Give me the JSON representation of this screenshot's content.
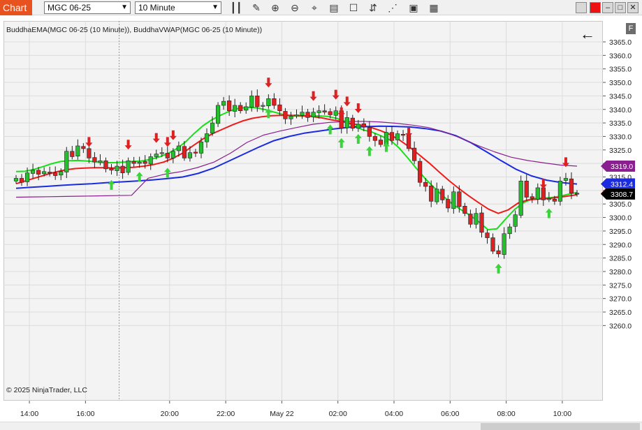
{
  "toolbar": {
    "tab_label": "Chart",
    "instrument": "MGC 06-25",
    "interval": "10 Minute",
    "icons": [
      "bar-type-icon",
      "draw-pencil-icon",
      "zoom-in-icon",
      "zoom-out-icon",
      "crosshair-icon",
      "properties-icon",
      "data-box-icon",
      "indicators-icon",
      "strategies-icon",
      "templates-icon",
      "filters-icon"
    ],
    "window_buttons": [
      "window-restore-icon",
      "window-close-icon",
      "window-minimize-icon",
      "window-maximize-icon",
      "window-pin-icon"
    ]
  },
  "indicator_label": "BuddhaEMA(MGC 06-25 (10 Minute)), BuddhaVWAP(MGC 06-25 (10 Minute))",
  "copyright": "© 2025 NinjaTrader, LLC",
  "back_arrow": "←",
  "f_button": "F",
  "colors": {
    "up": "#22c12b",
    "down": "#e02020",
    "ema_fast": "#18e018",
    "ema_slow": "#ee1b1b",
    "vwap": "#1a2be0",
    "vwap_band": "#8a1f8f",
    "signal_up": "#3bd23b",
    "signal_down": "#dd2020",
    "grid": "#dcdcdc"
  },
  "chart_data": {
    "type": "candlestick",
    "ylim": [
      3258,
      3368
    ],
    "y_ticks": [
      "3365.0",
      "3360.0",
      "3355.0",
      "3350.0",
      "3345.0",
      "3340.0",
      "3335.0",
      "3330.0",
      "3325.0",
      "3320.0",
      "3315.0",
      "3310.0",
      "3305.0",
      "3300.0",
      "3295.0",
      "3290.0",
      "3285.0",
      "3280.0",
      "3275.0",
      "3270.0",
      "3265.0",
      "3260.0"
    ],
    "x_ticks": [
      {
        "label": "14:00",
        "bar": 2
      },
      {
        "label": "16:00",
        "bar": 12
      },
      {
        "label": "20:00",
        "bar": 27
      },
      {
        "label": "22:00",
        "bar": 37
      },
      {
        "label": "May 22",
        "bar": 47
      },
      {
        "label": "02:00",
        "bar": 57
      },
      {
        "label": "04:00",
        "bar": 67
      },
      {
        "label": "06:00",
        "bar": 77
      },
      {
        "label": "08:00",
        "bar": 87
      },
      {
        "label": "10:00",
        "bar": 97
      }
    ],
    "session_break_bar": 18.5,
    "closes": [
      3314.5,
      3313.0,
      3316.5,
      3317.5,
      3316.0,
      3317.0,
      3316.5,
      3315.5,
      3317.0,
      3324.5,
      3322.5,
      3326.5,
      3325.5,
      3322.0,
      3320.5,
      3321.0,
      3318.0,
      3317.5,
      3319.0,
      3316.5,
      3321.0,
      3320.0,
      3320.5,
      3320.0,
      3322.5,
      3323.5,
      3324.0,
      3322.0,
      3324.5,
      3326.5,
      3322.0,
      3324.0,
      3324.0,
      3328.0,
      3331.0,
      3335.0,
      3341.5,
      3343.0,
      3339.5,
      3341.5,
      3339.5,
      3341.0,
      3345.0,
      3341.0,
      3341.5,
      3344.0,
      3341.5,
      3339.5,
      3336.5,
      3337.5,
      3338.0,
      3339.0,
      3337.0,
      3339.0,
      3339.5,
      3339.0,
      3338.0,
      3339.5,
      3333.0,
      3337.0,
      3333.0,
      3334.5,
      3333.5,
      3330.0,
      3328.5,
      3327.0,
      3331.5,
      3328.5,
      3331.0,
      3330.5,
      3325.5,
      3321.0,
      3313.0,
      3311.5,
      3306.0,
      3310.5,
      3306.5,
      3303.5,
      3309.5,
      3304.0,
      3301.5,
      3297.5,
      3301.5,
      3294.5,
      3292.5,
      3287.5,
      3286.5,
      3294.0,
      3296.5,
      3301.0,
      3313.5,
      3307.5,
      3307.0,
      3311.0,
      3306.5,
      3307.0,
      3306.0,
      3313.5,
      3314.5,
      3309.0,
      3308.7
    ],
    "signals_up": [
      17,
      22,
      27,
      45,
      56,
      58,
      61,
      63,
      66,
      86,
      95
    ],
    "signals_down": [
      13,
      20,
      25,
      27,
      28,
      45,
      53,
      57,
      58,
      59,
      61,
      70,
      94,
      98
    ],
    "series": [
      {
        "name": "BuddhaEMA fast",
        "values": [
          3317.0,
          3317.1,
          3317.8,
          3318.8,
          3319.9,
          3320.7,
          3321.0,
          3321.1,
          3320.9,
          3320.6,
          3320.3,
          3320.3,
          3320.5,
          3320.7,
          3320.9,
          3321.4,
          3322.3,
          3323.6,
          3325.4,
          3327.9,
          3331.1,
          3334.0,
          3336.2,
          3337.9,
          3339.4,
          3340.4,
          3340.8,
          3340.6,
          3339.9,
          3339.0,
          3338.1,
          3337.6,
          3337.5,
          3337.6,
          3337.6,
          3337.4,
          3336.7,
          3335.5,
          3333.9,
          3332.4,
          3331.6,
          3330.2,
          3328.7,
          3325.8,
          3322.0,
          3318.0,
          3314.2,
          3310.9,
          3307.8,
          3305.0,
          3302.8,
          3300.8,
          3298.3,
          3295.5,
          3295.8,
          3299.5,
          3303.0,
          3305.5,
          3306.9,
          3307.2,
          3307.3,
          3307.8,
          3308.6,
          3309.3
        ],
        "x_start": 0,
        "x_step": 1.58
      },
      {
        "name": "BuddhaEMA slow",
        "values": [
          3312.5,
          3313.6,
          3314.7,
          3315.8,
          3316.8,
          3317.6,
          3318.1,
          3318.3,
          3318.4,
          3318.4,
          3318.3,
          3318.4,
          3318.6,
          3319.0,
          3319.6,
          3320.5,
          3322.0,
          3324.0,
          3326.6,
          3329.1,
          3331.1,
          3332.7,
          3334.3,
          3335.7,
          3336.7,
          3337.3,
          3337.7,
          3337.8,
          3337.8,
          3337.7,
          3337.4,
          3336.9,
          3336.2,
          3335.6,
          3334.8,
          3334.2,
          3333.4,
          3332.2,
          3330.7,
          3328.6,
          3326.0,
          3323.1,
          3320.1,
          3316.8,
          3313.6,
          3310.7,
          3308.0,
          3305.5,
          3303.1,
          3301.5,
          3302.8,
          3305.3,
          3306.5,
          3306.8,
          3307.0,
          3307.4,
          3307.9,
          3308.4
        ],
        "x_start": 0,
        "x_step": 1.78
      },
      {
        "name": "BuddhaVWAP",
        "values": [
          3310.8,
          3311.2,
          3311.5,
          3311.9,
          3312.2,
          3312.5,
          3312.9,
          3313.2,
          3313.5,
          3313.9,
          3314.4,
          3315.0,
          3316.3,
          3318.2,
          3320.8,
          3323.4,
          3326.0,
          3328.4,
          3330.0,
          3331.2,
          3332.0,
          3332.8,
          3333.4,
          3333.6,
          3333.8,
          3333.7,
          3333.5,
          3332.9,
          3332.0,
          3330.3,
          3327.7,
          3324.4,
          3321.0,
          3317.8,
          3315.4,
          3313.8,
          3312.9,
          3312.4
        ],
        "x_start": 0,
        "x_step": 2.64
      },
      {
        "name": "BuddhaVWAP band",
        "values": [
          3307.5,
          3307.6,
          3307.7,
          3307.8,
          3307.9,
          3308.0,
          3308.1,
          3308.2,
          3314.5,
          3316.0,
          3317.0,
          3318.5,
          3320.5,
          3323.8,
          3327.8,
          3330.5,
          3332.0,
          3333.3,
          3334.5,
          3335.2,
          3335.5,
          3335.6,
          3335.4,
          3334.9,
          3334.2,
          3333.3,
          3331.6,
          3329.3,
          3326.6,
          3324.3,
          3322.3,
          3321.1,
          3320.2,
          3319.4,
          3319.0
        ],
        "x_start": 0,
        "x_step": 2.85
      }
    ],
    "price_tags": [
      {
        "label": "3319.0",
        "value": 3319.0,
        "color": "#8a1f8f"
      },
      {
        "label": "3312.4",
        "value": 3312.4,
        "color": "#1a2be0"
      },
      {
        "label": "3308.9",
        "value": 3308.9,
        "color": "#e02020"
      },
      {
        "label": "3308.7",
        "value": 3308.7,
        "color": "#000000"
      }
    ]
  }
}
